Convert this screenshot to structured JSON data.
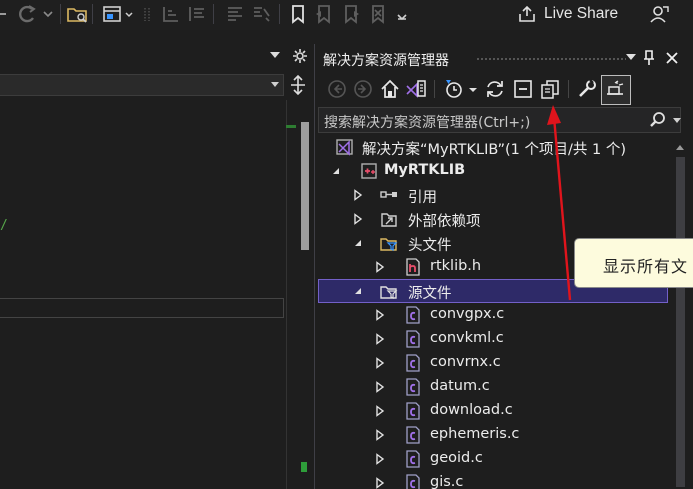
{
  "toolbar": {
    "live_share_label": "Live Share",
    "icons": [
      "undo-arrow-icon",
      "open-folder-icon",
      "window-layout-icon",
      "bookmark-icon"
    ]
  },
  "solution_explorer": {
    "title": "解决方案资源管理器",
    "search_placeholder": "搜索解决方案资源管理器(Ctrl+;)",
    "tooltip": "显示所有文",
    "tree": {
      "solution": "解决方案“MyRTKLIB”(1 个项目/共 1 个)",
      "project": "MyRTKLIB",
      "references": "引用",
      "external_deps": "外部依赖项",
      "header_folder": "头文件",
      "header_file": "rtklib.h",
      "source_folder": "源文件",
      "source_files": [
        "convgpx.c",
        "convkml.c",
        "convrnx.c",
        "datum.c",
        "download.c",
        "ephemeris.c",
        "geoid.c",
        "gis.c"
      ]
    }
  },
  "editor": {
    "code_fragment": "/"
  },
  "colors": {
    "background": "#1e1e1e",
    "selection": "#2e2a68",
    "selection_border": "#7360c8",
    "tooltip_bg": "#fdfbdd",
    "annotation_arrow": "#e0141c",
    "accent": "#3794ff"
  }
}
